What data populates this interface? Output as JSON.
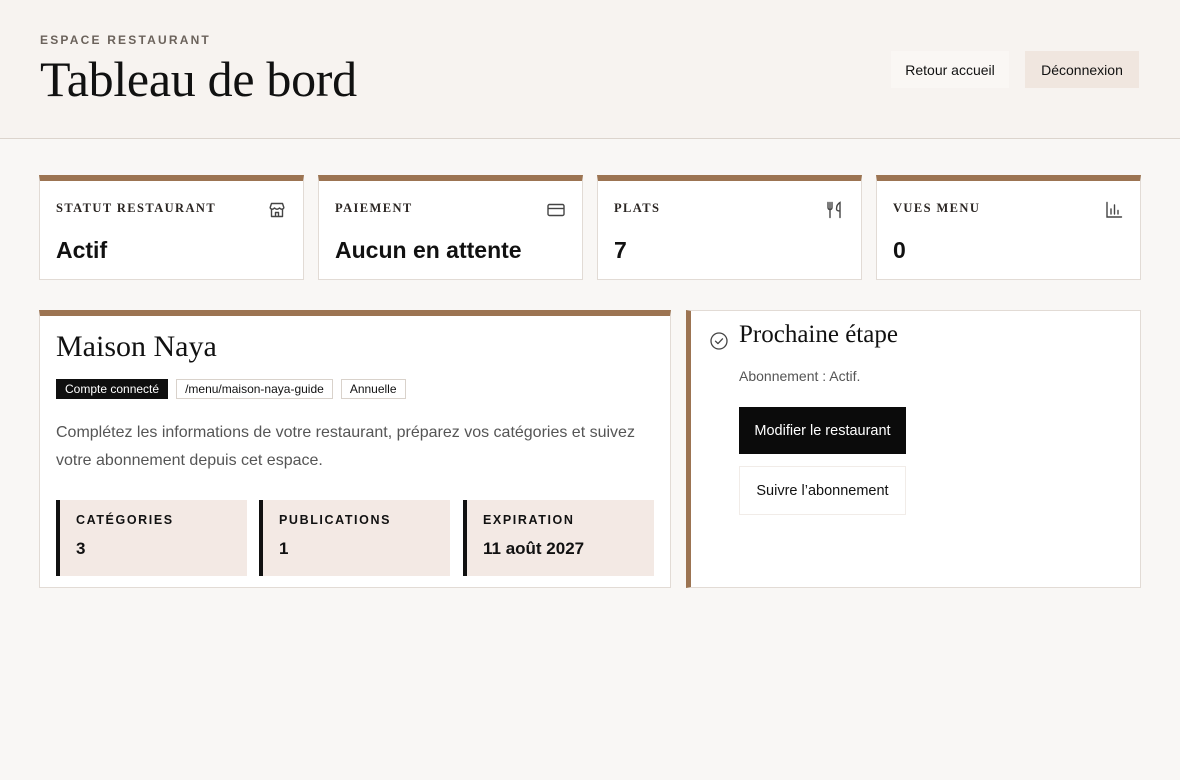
{
  "header": {
    "eyebrow": "ESPACE RESTAURANT",
    "title": "Tableau de bord",
    "home_label": "Retour accueil",
    "logout_label": "Déconnexion"
  },
  "stats": [
    {
      "label": "STATUT RESTAURANT",
      "value": "Actif",
      "icon": "store-icon"
    },
    {
      "label": "PAIEMENT",
      "value": "Aucun en attente",
      "icon": "credit-card-icon"
    },
    {
      "label": "PLATS",
      "value": "7",
      "icon": "utensils-icon"
    },
    {
      "label": "VUES MENU",
      "value": "0",
      "icon": "bar-chart-icon"
    }
  ],
  "restaurant": {
    "name": "Maison Naya",
    "tags": [
      "Compte connecté",
      "/menu/maison-naya-guide",
      "Annuelle"
    ],
    "description": "Complétez les informations de votre restaurant, préparez vos catégories et suivez votre abonnement depuis cet espace.",
    "metrics": [
      {
        "label": "CATÉGORIES",
        "value": "3"
      },
      {
        "label": "PUBLICATIONS",
        "value": "1"
      },
      {
        "label": "EXPIRATION",
        "value": "11 août 2027"
      }
    ]
  },
  "next_step": {
    "title": "Prochaine étape",
    "status": "Abonnement : Actif.",
    "edit_label": "Modifier le restaurant",
    "subscription_label": "Suivre l’abonnement",
    "icon": "check-circle-icon"
  },
  "colors": {
    "accent": "#9c7452",
    "background": "#f9f7f5",
    "header_bg": "#f7f3f0",
    "metric_bg": "#f3e9e4",
    "dark": "#0b0b0b"
  }
}
